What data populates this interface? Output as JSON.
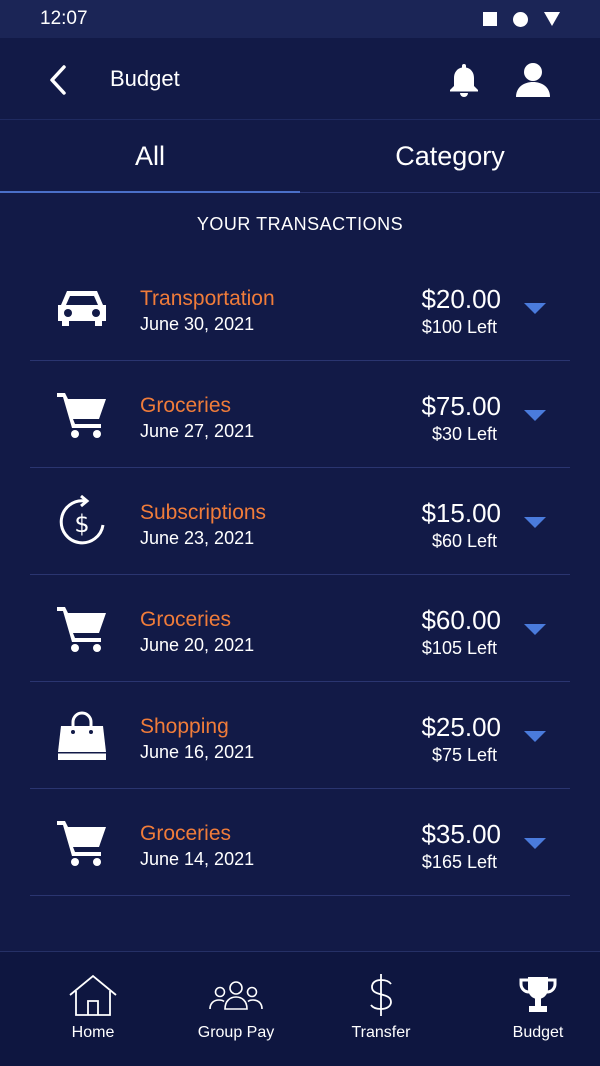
{
  "status_bar": {
    "time": "12:07"
  },
  "app_bar": {
    "title": "Budget",
    "back_icon": "chevron-left-icon",
    "notification_icon": "bell-icon",
    "profile_icon": "user-icon"
  },
  "tabs": [
    {
      "label": "All",
      "active": true
    },
    {
      "label": "Category",
      "active": false
    }
  ],
  "section_heading": "YOUR TRANSACTIONS",
  "colors": {
    "background": "#121a47",
    "accent": "#4a7bdc",
    "category": "#f07c3a"
  },
  "transactions": [
    {
      "category": "Transportation",
      "date": "June 30, 2021",
      "amount": "$20.00",
      "left": "$100 Left",
      "icon": "car-icon"
    },
    {
      "category": "Groceries",
      "date": "June 27, 2021",
      "amount": "$75.00",
      "left": "$30 Left",
      "icon": "cart-icon"
    },
    {
      "category": "Subscriptions",
      "date": "June 23, 2021",
      "amount": "$15.00",
      "left": "$60 Left",
      "icon": "dollar-cycle-icon"
    },
    {
      "category": "Groceries",
      "date": "June 20, 2021",
      "amount": "$60.00",
      "left": "$105 Left",
      "icon": "cart-icon"
    },
    {
      "category": "Shopping",
      "date": "June 16, 2021",
      "amount": "$25.00",
      "left": "$75 Left",
      "icon": "shopping-bag-icon"
    },
    {
      "category": "Groceries",
      "date": "June 14, 2021",
      "amount": "$35.00",
      "left": "$165 Left",
      "icon": "cart-icon"
    }
  ],
  "bottom_nav": [
    {
      "label": "Home",
      "icon": "home-icon"
    },
    {
      "label": "Group Pay",
      "icon": "group-icon"
    },
    {
      "label": "Transfer",
      "icon": "dollar-icon"
    },
    {
      "label": "Budget",
      "icon": "trophy-icon",
      "active": true
    }
  ]
}
